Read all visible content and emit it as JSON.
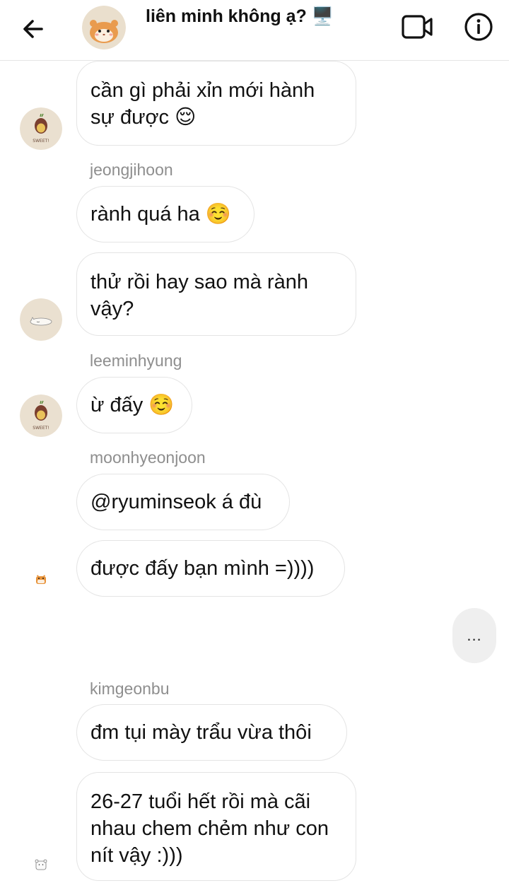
{
  "header": {
    "title": "liên minh không ạ? 🖥️",
    "back_icon": "arrow-left-icon",
    "video_icon": "video-camera-icon",
    "info_icon": "info-icon"
  },
  "messages": [
    {
      "text": "cần gì phải xỉn mới hành sự được 😌"
    },
    {
      "sender": "jeongjihoon",
      "text": "rành quá ha ☺️"
    },
    {
      "text": "thử rồi hay sao mà rành vậy?"
    },
    {
      "sender": "leeminhyung",
      "text": "ừ đấy ☺️"
    },
    {
      "sender": "moonhyeonjoon",
      "text": "@ryuminseok á đù"
    },
    {
      "text": "được đấy bạn mình =))))"
    },
    {
      "sender": "kimgeonbu",
      "text": "đm tụi mày trẩu vừa thôi"
    },
    {
      "text": "26-27 tuổi hết rồi mà cãi nhau chem chẻm như con nít vậy :)))"
    }
  ],
  "typing_indicator": "...",
  "avatar_labels": {
    "sweet": "SWEET!"
  },
  "colors": {
    "bubble_border": "#e4e4e4",
    "sender_name": "#8e8e8e",
    "typing_bg": "#efefef",
    "avatar_bg": "#eae0d0"
  }
}
